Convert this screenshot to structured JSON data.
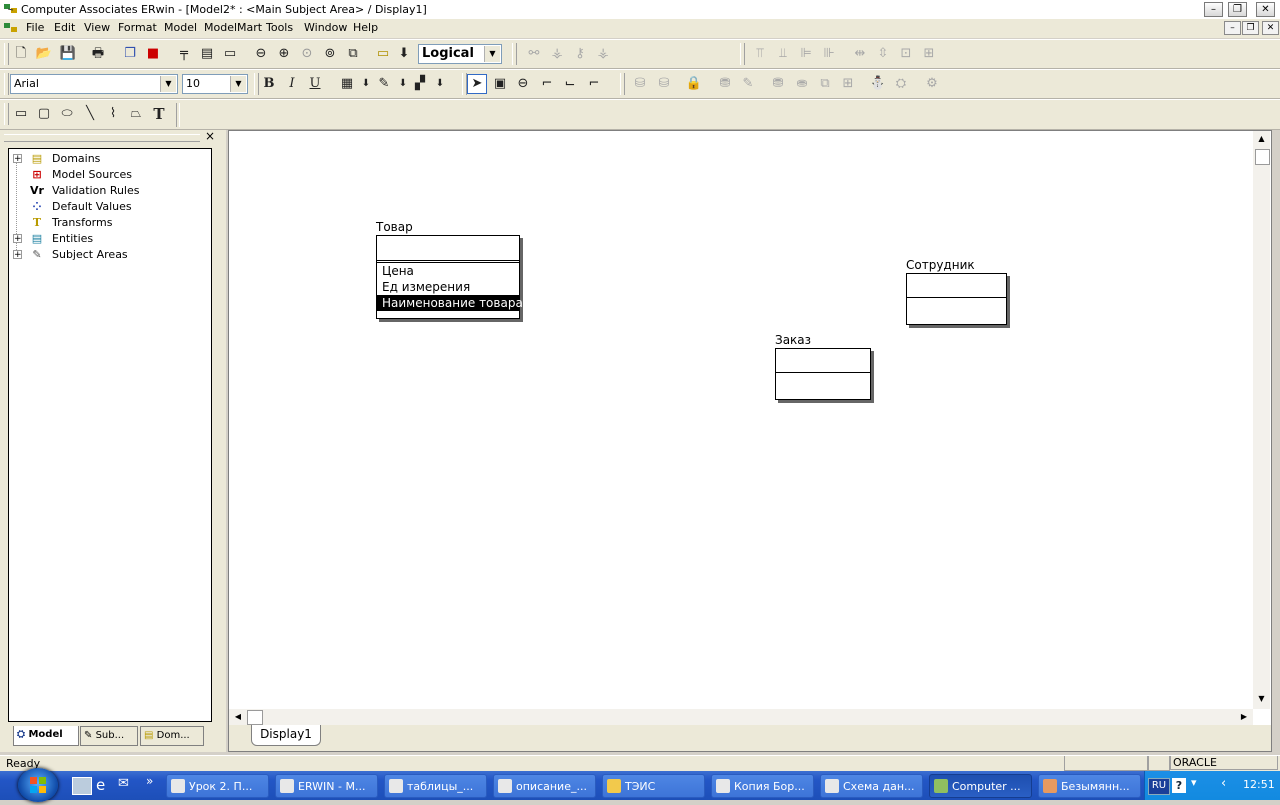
{
  "window": {
    "title": "Computer Associates ERwin - [Model2* : <Main Subject Area> / Display1]",
    "min_glyph": "–",
    "restore_glyph": "❐",
    "close_glyph": "✕"
  },
  "menu": [
    "File",
    "Edit",
    "View",
    "Format",
    "Model",
    "ModelMart",
    "Tools",
    "Window",
    "Help"
  ],
  "toolbar": {
    "view_mode": "Logical",
    "font_name": "Arial",
    "font_size": "10",
    "bold": "B",
    "italic": "I",
    "underline": "U",
    "text_tool": "T"
  },
  "tree": {
    "close_glyph": "×",
    "items": [
      {
        "label": "Domains",
        "icon": "domains-icon",
        "expandable": true
      },
      {
        "label": "Model Sources",
        "icon": "model-sources-icon",
        "expandable": false
      },
      {
        "label": "Validation Rules",
        "icon": "validation-rules-icon",
        "expandable": false
      },
      {
        "label": "Default Values",
        "icon": "default-values-icon",
        "expandable": false
      },
      {
        "label": "Transforms",
        "icon": "transforms-icon",
        "expandable": false
      },
      {
        "label": "Entities",
        "icon": "entities-icon",
        "expandable": true
      },
      {
        "label": "Subject Areas",
        "icon": "subject-areas-icon",
        "expandable": true
      }
    ],
    "tabs": [
      "Model",
      "Sub...",
      "Dom..."
    ]
  },
  "entities": [
    {
      "name": "Товар",
      "key_attrs": [],
      "attrs": [
        "Цена",
        "Ед измерения",
        "Наименование товара"
      ],
      "selected_attr": 2
    },
    {
      "name": "Сотрудник",
      "key_attrs": [],
      "attrs": []
    },
    {
      "name": "Заказ",
      "key_attrs": [],
      "attrs": []
    }
  ],
  "canvas": {
    "tab": "Display1"
  },
  "status": {
    "text": "Ready",
    "db": "ORACLE"
  },
  "taskbar": {
    "items": [
      "Урок 2. П...",
      "ERWIN - M...",
      "таблицы_...",
      "описание_...",
      "ТЭИС",
      "Копия Бор...",
      "Схема дан...",
      "Computer ...",
      "Безымянн..."
    ],
    "active_index": 7,
    "lang": "RU",
    "clock": "12:51",
    "more_glyph": "»"
  }
}
